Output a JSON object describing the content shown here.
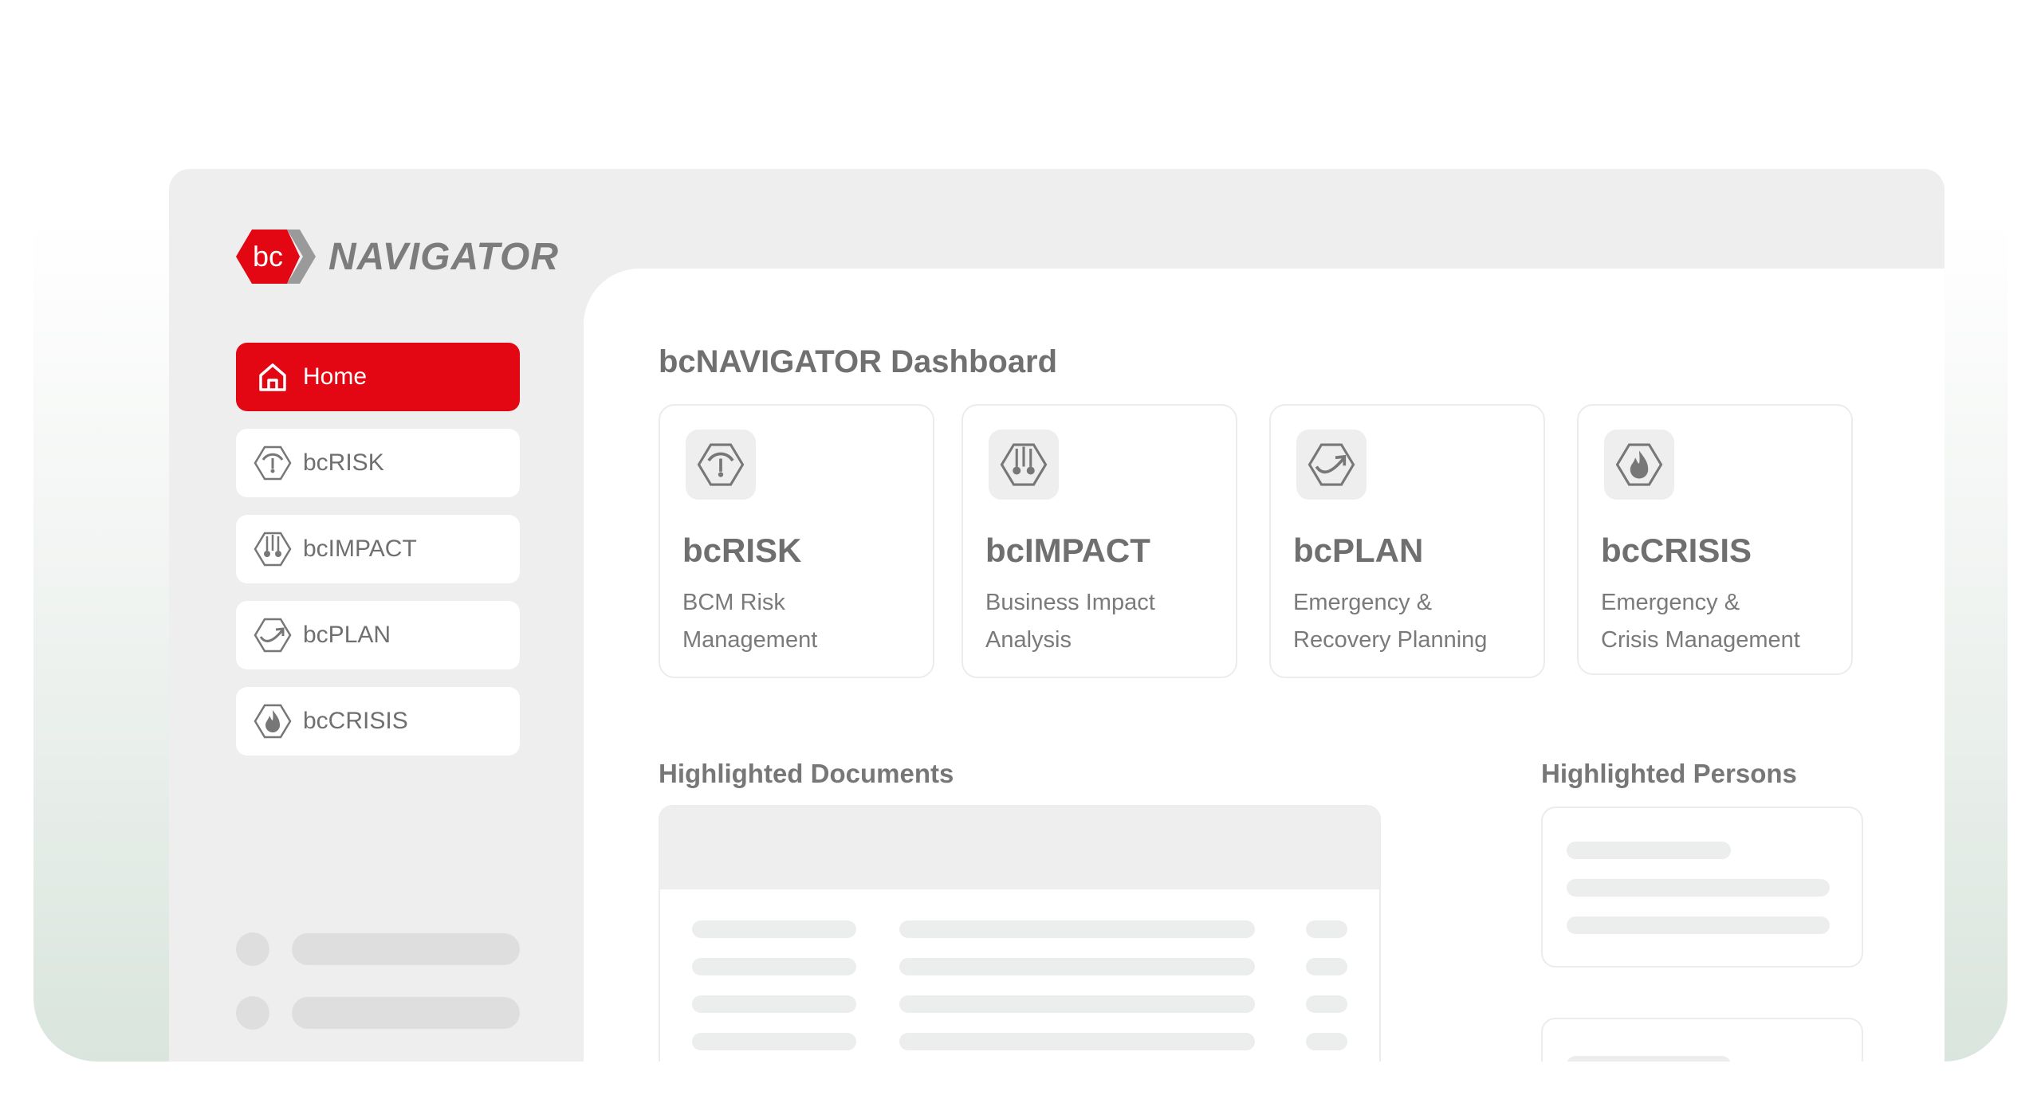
{
  "brand": {
    "logo_mark": "bc",
    "name": "NAVIGATOR",
    "colors": {
      "accent": "#e30613",
      "chevron": "#9a9a9a"
    }
  },
  "sidebar": {
    "items": [
      {
        "label": "Home",
        "icon": "home-icon",
        "active": true
      },
      {
        "label": "bcRISK",
        "icon": "gauge-icon",
        "active": false
      },
      {
        "label": "bcIMPACT",
        "icon": "impact-icon",
        "active": false
      },
      {
        "label": "bcPLAN",
        "icon": "plan-arrow-icon",
        "active": false
      },
      {
        "label": "bcCRISIS",
        "icon": "flame-icon",
        "active": false
      }
    ]
  },
  "dashboard": {
    "title": "bcNAVIGATOR Dashboard",
    "cards": [
      {
        "title": "bcRISK",
        "desc_line1": "BCM Risk",
        "desc_line2": "Management",
        "icon": "gauge-icon"
      },
      {
        "title": "bcIMPACT",
        "desc_line1": "Business Impact",
        "desc_line2": "Analysis",
        "icon": "impact-icon"
      },
      {
        "title": "bcPLAN",
        "desc_line1": "Emergency &",
        "desc_line2": "Recovery Planning",
        "icon": "plan-arrow-icon"
      },
      {
        "title": "bcCRISIS",
        "desc_line1": "Emergency &",
        "desc_line2": "Crisis Management",
        "icon": "flame-icon"
      }
    ]
  },
  "sections": {
    "documents_title": "Highlighted Documents",
    "persons_title": "Highlighted Persons"
  }
}
